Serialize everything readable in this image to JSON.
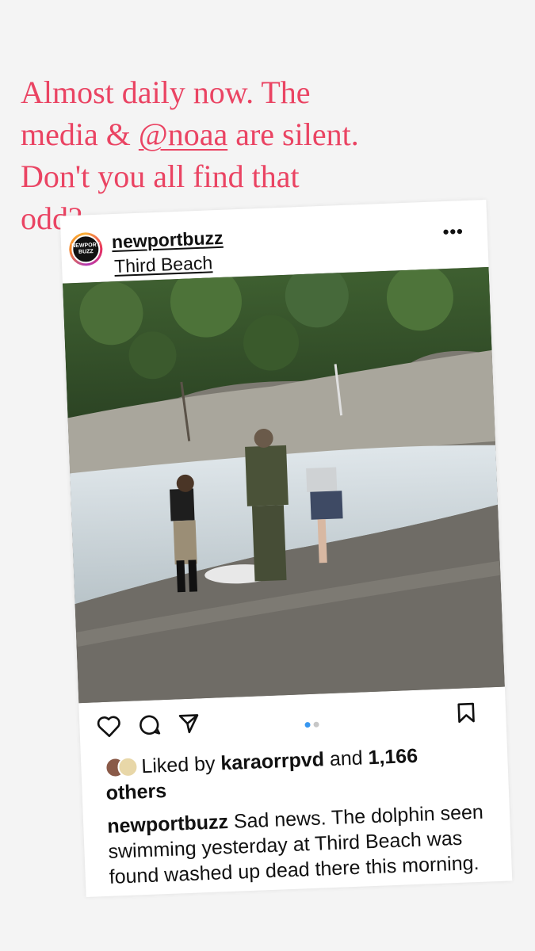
{
  "story": {
    "line1": "Almost daily now. The",
    "line2_before": "media & ",
    "mention": "@noaa",
    "line2_after": " are silent.",
    "line3": "Don't you all find that",
    "line4": "odd?"
  },
  "post": {
    "avatar_text_1": "NEWPORT",
    "avatar_text_2": "BUZZ",
    "username": "newportbuzz",
    "location": "Third Beach",
    "more_icon": "more-horizontal-icon",
    "carousel": {
      "count": 2,
      "active_index": 0
    },
    "liked_by_prefix": "Liked by ",
    "liked_by_user": "karaorrpvd",
    "liked_by_and": " and ",
    "liked_by_count": "1,166",
    "liked_by_suffix": "others",
    "caption_user": "newportbuzz",
    "caption_text": " Sad news. The dolphin seen swimming yesterday at Third Beach was found washed up dead there this morning."
  },
  "colors": {
    "story_text": "#ea4463",
    "carousel_active": "#3897f0",
    "carousel_inactive": "#c7c7c7"
  }
}
